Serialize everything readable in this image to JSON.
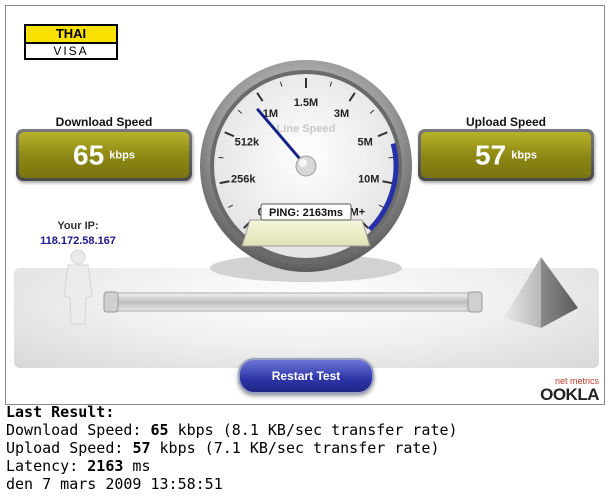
{
  "logo": {
    "top": "THAI",
    "bottom": "VISA"
  },
  "download": {
    "label": "Download Speed",
    "value": "65",
    "unit": "kbps"
  },
  "upload": {
    "label": "Upload Speed",
    "value": "57",
    "unit": "kbps"
  },
  "ip": {
    "label": "Your IP:",
    "value": "118.172.58.167"
  },
  "gauge": {
    "title": "Line Speed",
    "ticks": [
      "0",
      "256k",
      "512k",
      "1M",
      "1.5M",
      "3M",
      "5M",
      "10M",
      "20M+"
    ],
    "needle_fraction": 0.35,
    "ping_text": "PING: 2163ms"
  },
  "restart_button": "Restart Test",
  "ookla": {
    "small": "net metrics",
    "word": "OOKLA"
  },
  "results": {
    "heading": "Last Result:",
    "download_prefix": "Download Speed: ",
    "download_value": "65",
    "download_suffix": " kbps (8.1 KB/sec transfer rate)",
    "upload_prefix": "Upload Speed: ",
    "upload_value": "57",
    "upload_suffix": " kbps (7.1 KB/sec transfer rate)",
    "latency_prefix": "Latency: ",
    "latency_value": "2163",
    "latency_suffix": " ms",
    "date": "den 7 mars 2009 13:58:51"
  },
  "colors": {
    "speed_box": "#8c8614",
    "button": "#2d35a6",
    "needle": "#1f2a9a",
    "ip_text": "#1a1a8a"
  }
}
